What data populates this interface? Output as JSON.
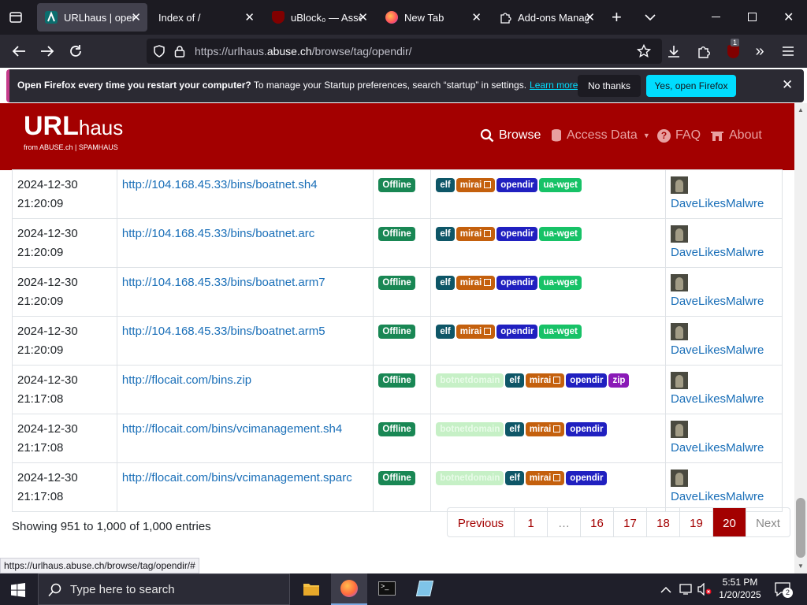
{
  "browser": {
    "tabs": [
      {
        "title": "URLhaus | open",
        "active": true
      },
      {
        "title": "Index of /",
        "active": false
      },
      {
        "title": "uBlock₀ — Asse",
        "active": false
      },
      {
        "title": "New Tab",
        "active": false
      },
      {
        "title": "Add-ons Manag",
        "active": false
      }
    ],
    "url_prefix": "https://urlhaus.",
    "url_domain": "abuse.ch",
    "url_path": "/browse/tag/opendir/",
    "extension_badge": "1"
  },
  "notification": {
    "bold": "Open Firefox every time you restart your computer?",
    "text": " To manage your Startup preferences, search “startup” in settings.",
    "link": "Learn more",
    "no_thanks": "No thanks",
    "yes": "Yes, open Firefox"
  },
  "site": {
    "logo": "URL",
    "logo_suffix": "haus",
    "logo_sub": "from ABUSE.ch  |  SPAMHAUS",
    "nav": {
      "browse": "Browse",
      "access_data": "Access Data",
      "faq": "FAQ",
      "about": "About"
    }
  },
  "rows": [
    {
      "date": "2024-12-30",
      "time": "21:20:09",
      "url": "http://104.168.45.33/bins/boatnet.sh4",
      "status": "Offline",
      "tags": [
        "elf",
        "mirai",
        "opendir",
        "ua-wget"
      ],
      "reporter": "DaveLikesMalwre"
    },
    {
      "date": "2024-12-30",
      "time": "21:20:09",
      "url": "http://104.168.45.33/bins/boatnet.arc",
      "status": "Offline",
      "tags": [
        "elf",
        "mirai",
        "opendir",
        "ua-wget"
      ],
      "reporter": "DaveLikesMalwre"
    },
    {
      "date": "2024-12-30",
      "time": "21:20:09",
      "url": "http://104.168.45.33/bins/boatnet.arm7",
      "status": "Offline",
      "tags": [
        "elf",
        "mirai",
        "opendir",
        "ua-wget"
      ],
      "reporter": "DaveLikesMalwre"
    },
    {
      "date": "2024-12-30",
      "time": "21:20:09",
      "url": "http://104.168.45.33/bins/boatnet.arm5",
      "status": "Offline",
      "tags": [
        "elf",
        "mirai",
        "opendir",
        "ua-wget"
      ],
      "reporter": "DaveLikesMalwre"
    },
    {
      "date": "2024-12-30",
      "time": "21:17:08",
      "url": "http://flocait.com/bins.zip",
      "status": "Offline",
      "tags": [
        "botnetdomain",
        "elf",
        "mirai",
        "opendir",
        "zip"
      ],
      "reporter": "DaveLikesMalwre"
    },
    {
      "date": "2024-12-30",
      "time": "21:17:08",
      "url": "http://flocait.com/bins/vcimanagement.sh4",
      "status": "Offline",
      "tags": [
        "botnetdomain",
        "elf",
        "mirai",
        "opendir"
      ],
      "reporter": "DaveLikesMalwre"
    },
    {
      "date": "2024-12-30",
      "time": "21:17:08",
      "url": "http://flocait.com/bins/vcimanagement.sparc",
      "status": "Offline",
      "tags": [
        "botnetdomain",
        "elf",
        "mirai",
        "opendir"
      ],
      "reporter": "DaveLikesMalwre"
    }
  ],
  "info": "Showing 951 to 1,000 of 1,000 entries",
  "pagination": [
    "Previous",
    "1",
    "…",
    "16",
    "17",
    "18",
    "19",
    "20",
    "Next"
  ],
  "pagination_active": "20",
  "status_url": "https://urlhaus.abuse.ch/browse/tag/opendir/#",
  "taskbar": {
    "search_placeholder": "Type here to search",
    "time": "5:51 PM",
    "date": "1/20/2025",
    "notif_count": "2"
  },
  "colors": {
    "brand": "#a30000",
    "offline": "#198754",
    "elf": "#0e5667",
    "mirai": "#c4600d",
    "opendir": "#2020c0",
    "ua-wget": "#17c267",
    "zip": "#8a1ab7"
  }
}
